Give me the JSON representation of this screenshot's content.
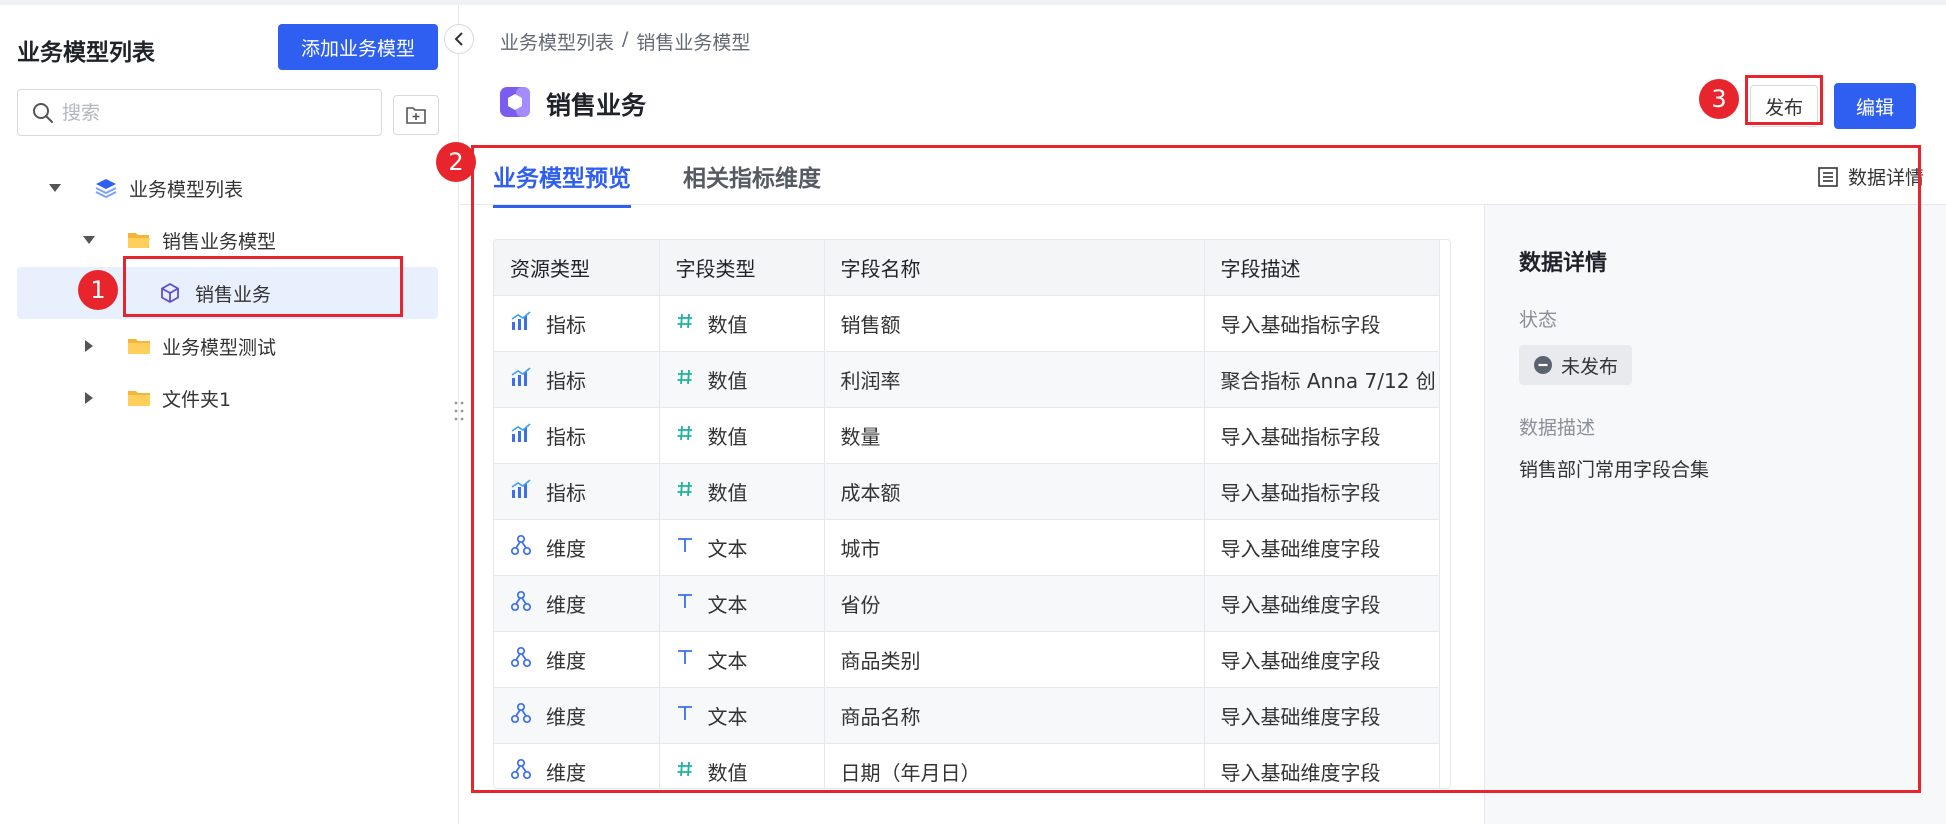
{
  "sidebar": {
    "title": "业务模型列表",
    "add_button": "添加业务模型",
    "search_placeholder": "搜索",
    "tree": [
      {
        "label": "业务模型列表",
        "icon": "layers-icon",
        "expanded": true
      },
      {
        "label": "销售业务模型",
        "icon": "folder-open-icon",
        "expanded": true
      },
      {
        "label": "销售业务",
        "icon": "cube-icon",
        "selected": true
      },
      {
        "label": "业务模型测试",
        "icon": "folder-icon",
        "expanded": false
      },
      {
        "label": "文件夹1",
        "icon": "folder-icon",
        "expanded": false
      }
    ]
  },
  "breadcrumb": [
    "业务模型列表",
    "/",
    "销售业务模型"
  ],
  "page": {
    "title": "销售业务",
    "publish_button": "发布",
    "edit_button": "编辑"
  },
  "tabs": [
    {
      "label": "业务模型预览",
      "active": true
    },
    {
      "label": "相关指标维度",
      "active": false
    }
  ],
  "data_detail_link": "数据详情",
  "table": {
    "columns": [
      "资源类型",
      "字段类型",
      "字段名称",
      "字段描述"
    ],
    "rows": [
      {
        "resource": "指标",
        "resource_icon": "metric-icon",
        "type": "数值",
        "type_icon": "hash-icon",
        "name": "销售额",
        "desc": "导入基础指标字段"
      },
      {
        "resource": "指标",
        "resource_icon": "metric-icon",
        "type": "数值",
        "type_icon": "hash-icon",
        "name": "利润率",
        "desc": "聚合指标 Anna 7/12 创"
      },
      {
        "resource": "指标",
        "resource_icon": "metric-icon",
        "type": "数值",
        "type_icon": "hash-icon",
        "name": "数量",
        "desc": "导入基础指标字段"
      },
      {
        "resource": "指标",
        "resource_icon": "metric-icon",
        "type": "数值",
        "type_icon": "hash-icon",
        "name": "成本额",
        "desc": "导入基础指标字段"
      },
      {
        "resource": "维度",
        "resource_icon": "dimension-icon",
        "type": "文本",
        "type_icon": "text-icon",
        "name": "城市",
        "desc": "导入基础维度字段"
      },
      {
        "resource": "维度",
        "resource_icon": "dimension-icon",
        "type": "文本",
        "type_icon": "text-icon",
        "name": "省份",
        "desc": "导入基础维度字段"
      },
      {
        "resource": "维度",
        "resource_icon": "dimension-icon",
        "type": "文本",
        "type_icon": "text-icon",
        "name": "商品类别",
        "desc": "导入基础维度字段"
      },
      {
        "resource": "维度",
        "resource_icon": "dimension-icon",
        "type": "文本",
        "type_icon": "text-icon",
        "name": "商品名称",
        "desc": "导入基础维度字段"
      },
      {
        "resource": "维度",
        "resource_icon": "dimension-icon",
        "type": "数值",
        "type_icon": "hash-icon",
        "name": "日期（年月日）",
        "desc": "导入基础维度字段"
      }
    ]
  },
  "details": {
    "title": "数据详情",
    "status_label": "状态",
    "status_value": "未发布",
    "desc_label": "数据描述",
    "desc_value": "销售部门常用字段合集"
  },
  "annotations": [
    "1",
    "2",
    "3"
  ],
  "colors": {
    "primary": "#2f5ff0",
    "annotation_red": "#e8242c",
    "selected_bg": "#e8effd"
  }
}
